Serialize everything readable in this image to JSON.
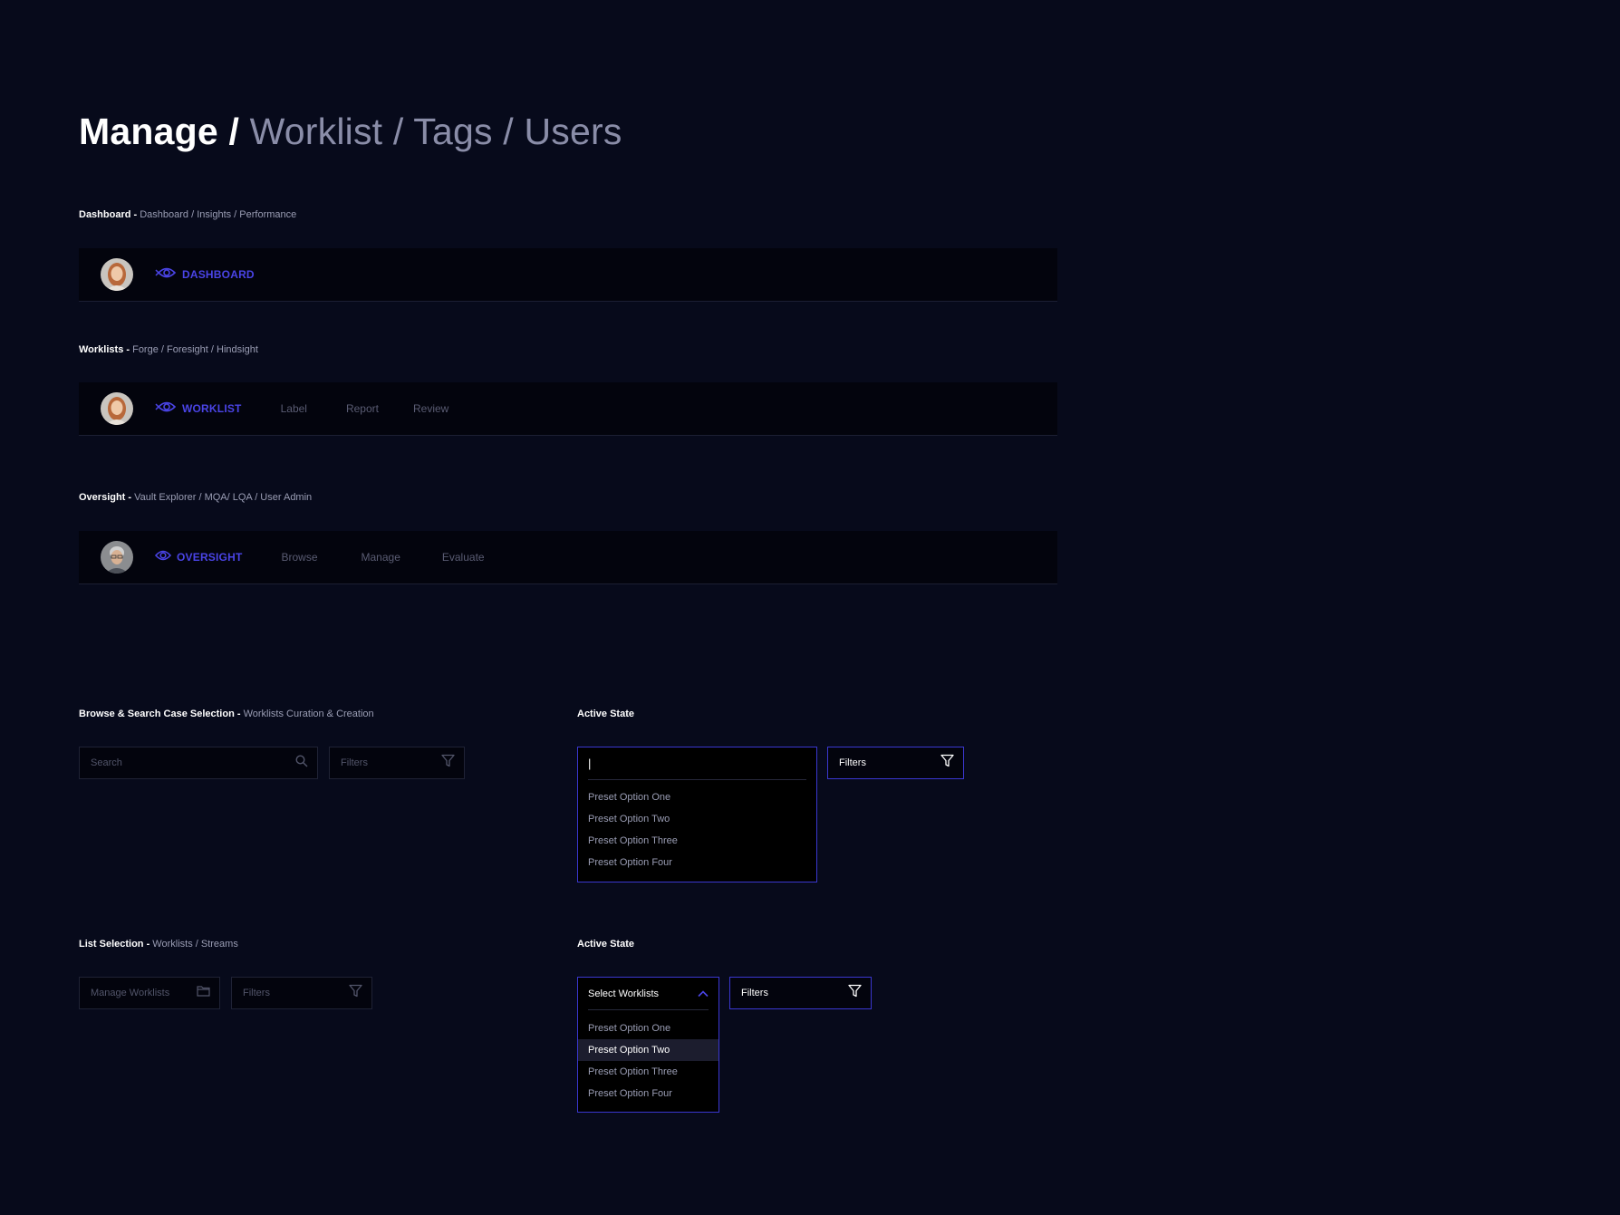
{
  "page_title": {
    "main": "Manage",
    "sep": " / ",
    "rest": "Worklist / Tags / Users"
  },
  "sections": {
    "dashboard": {
      "label": "Dashboard - ",
      "sub": "Dashboard / Insights / Performance",
      "brand": "DASHBOARD",
      "items": []
    },
    "worklists": {
      "label": "Worklists - ",
      "sub": "Forge / Foresight / Hindsight",
      "brand": "WORKLIST",
      "items": [
        "Label",
        "Report",
        "Review"
      ]
    },
    "oversight": {
      "label": "Oversight - ",
      "sub": "Vault Explorer / MQA/ LQA / User Admin",
      "brand": "OVERSIGHT",
      "items": [
        "Browse",
        "Manage",
        "Evaluate"
      ]
    }
  },
  "browse": {
    "label": "Browse & Search Case Selection - ",
    "sub": "Worklists Curation & Creation",
    "search_placeholder": "Search",
    "filters_placeholder": "Filters",
    "active_label": "Active State",
    "active_cursor": "|",
    "active_filters": "Filters",
    "options": [
      "Preset Option One",
      "Preset Option Two",
      "Preset Option Three",
      "Preset Option Four"
    ]
  },
  "list": {
    "label": "List Selection - ",
    "sub": "Worklists / Streams",
    "manage_placeholder": "Manage Worklists",
    "filters_placeholder": "Filters",
    "active_label": "Active State",
    "select_value": "Select Worklists",
    "active_filters": "Filters",
    "options": [
      "Preset Option One",
      "Preset Option Two",
      "Preset Option Three",
      "Preset Option Four"
    ],
    "selected_index": 1
  },
  "colors": {
    "accent": "#4a44e6",
    "background": "#070a1b",
    "bar": "#03040d",
    "muted": "#8a8da8"
  }
}
